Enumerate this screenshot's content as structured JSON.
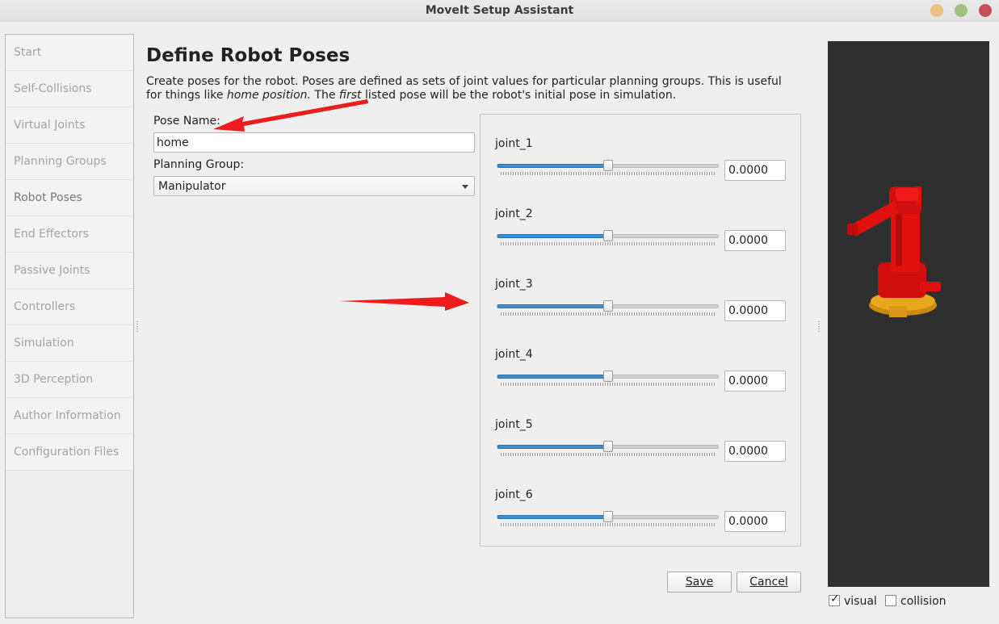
{
  "window": {
    "title": "MoveIt Setup Assistant"
  },
  "sidebar": {
    "items": [
      {
        "label": "Start"
      },
      {
        "label": "Self-Collisions"
      },
      {
        "label": "Virtual Joints"
      },
      {
        "label": "Planning Groups"
      },
      {
        "label": "Robot Poses"
      },
      {
        "label": "End Effectors"
      },
      {
        "label": "Passive Joints"
      },
      {
        "label": "Controllers"
      },
      {
        "label": "Simulation"
      },
      {
        "label": "3D Perception"
      },
      {
        "label": "Author Information"
      },
      {
        "label": "Configuration Files"
      }
    ],
    "active": "Robot Poses"
  },
  "main": {
    "title": "Define Robot Poses",
    "desc_part1": "Create poses for the robot. Poses are defined as sets of joint values for particular planning groups. This is useful for things like ",
    "desc_em1": "home position.",
    "desc_part2": " The ",
    "desc_em2": "first",
    "desc_part3": " listed pose will be the robot's initial pose in simulation.",
    "pose_name_label": "Pose Name:",
    "pose_name_value": "home",
    "planning_group_label": "Planning Group:",
    "planning_group_value": "Manipulator"
  },
  "joints": [
    {
      "name": "joint_1",
      "value": "0.0000",
      "slider_fraction": 0.5
    },
    {
      "name": "joint_2",
      "value": "0.0000",
      "slider_fraction": 0.5
    },
    {
      "name": "joint_3",
      "value": "0.0000",
      "slider_fraction": 0.5
    },
    {
      "name": "joint_4",
      "value": "0.0000",
      "slider_fraction": 0.5
    },
    {
      "name": "joint_5",
      "value": "0.0000",
      "slider_fraction": 0.5
    },
    {
      "name": "joint_6",
      "value": "0.0000",
      "slider_fraction": 0.5
    }
  ],
  "buttons": {
    "save": "Save",
    "cancel": "Cancel"
  },
  "viewer": {
    "visual_label": "visual",
    "visual_checked": true,
    "collision_label": "collision",
    "collision_checked": false,
    "background_color": "#2f2f2f",
    "robot_color": "#e31010",
    "base_color": "#e8a81c"
  },
  "colors": {
    "slider_fill": "#3f8fd0",
    "annotation_arrow": "#ee1c1c"
  }
}
